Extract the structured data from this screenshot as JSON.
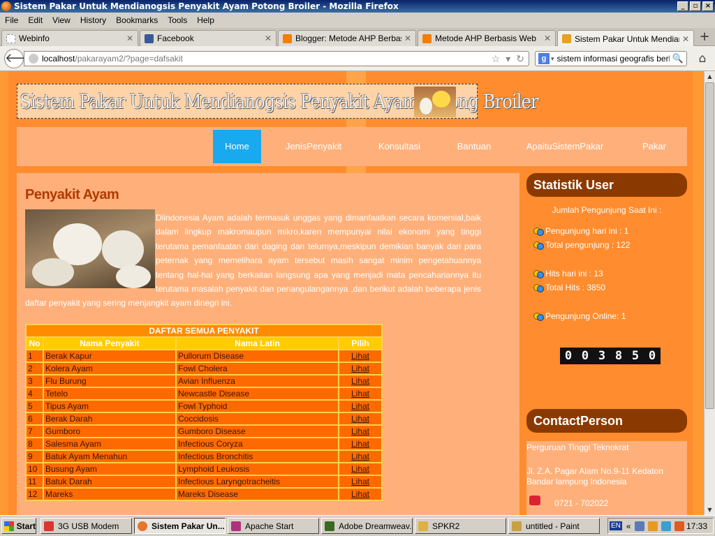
{
  "window": {
    "title": "Sistem Pakar Untuk Mendianogsis Penyakit Ayam Potong Broiler - Mozilla Firefox"
  },
  "menu": [
    "File",
    "Edit",
    "View",
    "History",
    "Bookmarks",
    "Tools",
    "Help"
  ],
  "tabs": [
    {
      "label": "Webinfo",
      "icon_color": "#ffffff"
    },
    {
      "label": "Facebook",
      "icon_color": "#3b5998"
    },
    {
      "label": "Blogger: Metode AHP Berbasis...",
      "icon_color": "#f57d00"
    },
    {
      "label": "Metode AHP Berbasis Web",
      "icon_color": "#f57d00"
    },
    {
      "label": "Sistem Pakar Untuk Mendianog...",
      "icon_color": "#e8a020"
    }
  ],
  "address": {
    "host": "localhost",
    "path": "/pakarayam2/?page=dafsakit"
  },
  "search": {
    "query": "sistem informasi geografis berbasi"
  },
  "site": {
    "header_title": "Sistem Pakar Untuk Mendianogsis Penyakit Ayam Potong Broiler",
    "nav": [
      {
        "label": "Home",
        "active": true
      },
      {
        "label": "JenisPenyakit",
        "active": false
      },
      {
        "label": "Konsultasi",
        "active": false
      },
      {
        "label": "Bantuan",
        "active": false
      },
      {
        "label": "ApaituSistemPakar",
        "active": false
      },
      {
        "label": "Pakar",
        "active": false
      }
    ],
    "main_title": "Penyakit Ayam",
    "intro": "Diindonesia Ayam adalah termasuk unggas yang dimanfaatkan secara komersial,baik dalam lingkup makromaupun mikro,karen mempunyai nilai ekonomi yang tinggi terutama pemanfaatan dari daging dan telurnya,meskipun demikian banyak dari para peternak yang memelihara ayam tersebut masih sangat minim pengetahuannya tentang hal-hal yang berkaitan langsung apa yang menjadi mata pencahariannya itu terutama masalah penyakit dan penangulangannya ,dan berikut adalah beberapa jenis daftar penyakit yang sering menjangkit ayam dinegri ini.",
    "table": {
      "caption": "DAFTAR SEMUA PENYAKIT",
      "headers": [
        "No",
        "Nama Penyakit",
        "Nama Latin",
        "Pilih"
      ],
      "rows": [
        [
          "1",
          "Berak Kapur",
          "Pullorum Disease",
          "Lihat"
        ],
        [
          "2",
          "Kolera Ayam",
          "Fowl Cholera",
          "Lihat"
        ],
        [
          "3",
          "Flu Burung",
          "Avian Influenza",
          "Lihat"
        ],
        [
          "4",
          "Tetelo",
          "Newcastle Disease",
          "Lihat"
        ],
        [
          "5",
          "Tipus Ayam",
          "Fowl Typhoid",
          "Lihat"
        ],
        [
          "6",
          "Berak Darah",
          "Coccidosis",
          "Lihat"
        ],
        [
          "7",
          "Gumboro",
          "Gumboro Disease",
          "Lihat"
        ],
        [
          "8",
          "Salesma Ayam",
          "Infectious Coryza",
          "Lihat"
        ],
        [
          "9",
          "Batuk Ayam Menahun",
          "Infectious Bronchitis",
          "Lihat"
        ],
        [
          "10",
          "Busung Ayam",
          "Lymphoid Leukosis",
          "Lihat"
        ],
        [
          "11",
          "Batuk Darah",
          "Infectious Laryngotracheitis",
          "Lihat"
        ],
        [
          "12",
          "Mareks",
          "Mareks Disease",
          "Lihat"
        ]
      ]
    },
    "stats": {
      "title": "Statistik User",
      "subtitle": "Jumlah Pengunjung Saat Ini :",
      "today": "Pengunjung hari ini : 1",
      "total": "Total pengunjung : 122",
      "hits_today": "Hits hari ini : 13",
      "hits_total": "Total Hits : 3850",
      "online": "Pengunjung Online: 1",
      "counter_digits": [
        "0",
        "0",
        "3",
        "8",
        "5",
        "0"
      ]
    },
    "contact": {
      "title": "ContactPerson",
      "line1": "Perguruan Tinggi Teknokrat",
      "line2": "Jl. Z.A. Pagar Alam No.9-11 Kedaton",
      "line3": "Bandar lampung Indonesia",
      "phone": "0721 - 702022"
    }
  },
  "taskbar": {
    "start": "Start",
    "tasks": [
      {
        "label": "3G USB Modem",
        "active": false,
        "icon_color": "#d33"
      },
      {
        "label": "Sistem Pakar Un...",
        "active": true,
        "icon_color": "#e8742a"
      },
      {
        "label": "Apache Start",
        "active": false,
        "icon_color": "#b03080"
      },
      {
        "label": "Adobe Dreamweav...",
        "active": false,
        "icon_color": "#3a6a20"
      },
      {
        "label": "SPKR2",
        "active": false,
        "icon_color": "#e0b040"
      },
      {
        "label": "untitled - Paint",
        "active": false,
        "icon_color": "#c8a040"
      }
    ],
    "lang": "EN",
    "clock": "17:33"
  }
}
